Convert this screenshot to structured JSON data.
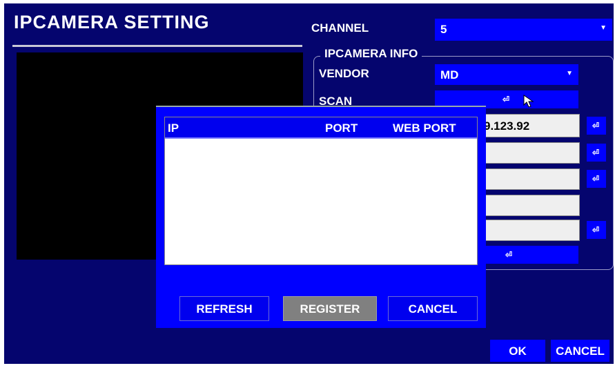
{
  "page_title": "IPCAMERA SETTING",
  "channel": {
    "label": "CHANNEL",
    "value": "5"
  },
  "group_title": "IPCAMERA INFO",
  "vendor": {
    "label": "VENDOR",
    "value": "MD"
  },
  "scan": {
    "label": "SCAN",
    "button_icon": "enter-icon"
  },
  "fields": {
    "ip_value": "9.123.92"
  },
  "icons": {
    "enter": "⏎"
  },
  "dialog": {
    "columns": [
      "IP",
      "PORT",
      "WEB PORT"
    ],
    "rows": [],
    "refresh_label": "REFRESH",
    "register_label": "REGISTER",
    "cancel_label": "CANCEL"
  },
  "footer": {
    "ok_label": "OK",
    "cancel_label": "CANCEL"
  },
  "colors": {
    "background": "#05056e",
    "accent": "#0000ff",
    "field": "#efefef",
    "disabled_button": "#808080"
  }
}
